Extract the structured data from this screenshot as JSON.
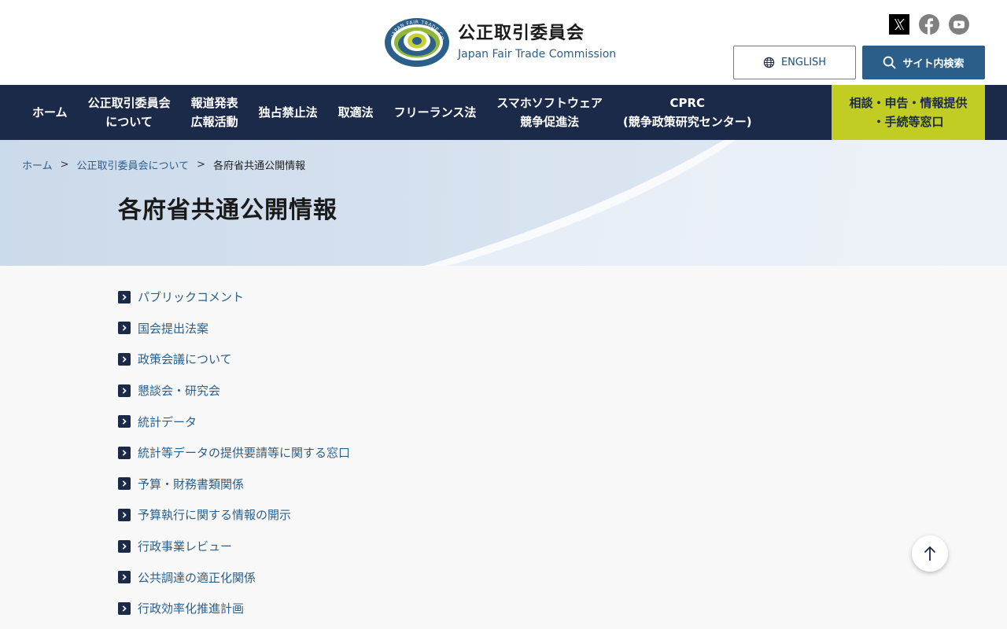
{
  "header": {
    "logo": {
      "title_ja": "公正取引委員会",
      "title_en": "Japan Fair Trade Commission",
      "seal_text": "JAPAN FAIR TRADE COMMISSION"
    },
    "social": [
      {
        "icon": "x-icon"
      },
      {
        "icon": "facebook-icon"
      },
      {
        "icon": "youtube-icon"
      }
    ],
    "english_label": "ENGLISH",
    "search_label": "サイト内検索"
  },
  "nav": {
    "items": [
      {
        "label": "ホーム"
      },
      {
        "label": "公正取引委員会\nについて"
      },
      {
        "label": "報道発表\n広報活動"
      },
      {
        "label": "独占禁止法"
      },
      {
        "label": "取適法"
      },
      {
        "label": "フリーランス法"
      },
      {
        "label": "スマホソフトウェア\n競争促進法"
      },
      {
        "label": "CPRC\n(競争政策研究センター)"
      }
    ],
    "consult_label": "相談・申告・情報提供\n・手続等窓口"
  },
  "breadcrumb": {
    "home": "ホーム",
    "about": "公正取引委員会について",
    "current": "各府省共通公開情報",
    "separator": ">"
  },
  "page": {
    "title": "各府省共通公開情報"
  },
  "links": [
    "パブリックコメント",
    "国会提出法案",
    "政策会議について",
    "懇談会・研究会",
    "統計データ",
    "統計等データの提供要請等に関する窓口",
    "予算・財務書類関係",
    "予算執行に関する情報の開示",
    "行政事業レビュー",
    "公共調達の適正化関係",
    "行政効率化推進計画"
  ],
  "colors": {
    "navy": "#1c2a4a",
    "link_blue": "#2b5f8a",
    "accent_lime": "#c2cd23"
  }
}
